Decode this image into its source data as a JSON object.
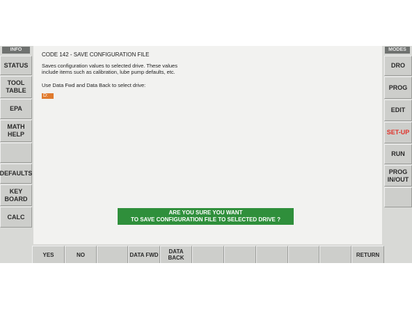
{
  "left_panel": {
    "header": "INFO",
    "buttons": [
      "STATUS",
      "TOOL\nTABLE",
      "EPA",
      "MATH\nHELP",
      "",
      "DEFAULTS",
      "KEY\nBOARD",
      "CALC"
    ]
  },
  "right_panel": {
    "header": "MODES",
    "buttons": [
      "DRO",
      "PROG",
      "EDIT",
      "SET-UP",
      "RUN",
      "PROG\nIN/OUT",
      ""
    ]
  },
  "main": {
    "code_title": "CODE 142 - SAVE CONFIGURATION FILE",
    "description": "Saves configuration values to selected drive.  These values\ninclude items such as calibration, lube pump defaults, etc.",
    "instruction": "Use Data Fwd and Data Back to select drive:",
    "selected_drive": "D:",
    "confirm_line1": "ARE YOU SURE YOU WANT",
    "confirm_line2": "TO SAVE CONFIGURATION FILE TO SELECTED DRIVE ?"
  },
  "bottom_bar": {
    "yes": "YES",
    "no": "NO",
    "data_fwd": "DATA FWD",
    "data_back": "DATA BACK",
    "return": "RETURN"
  },
  "colors": {
    "active_mode": "#e0332b",
    "confirm_bg": "#2f8f3b",
    "drive_highlight": "#e07a2d"
  }
}
